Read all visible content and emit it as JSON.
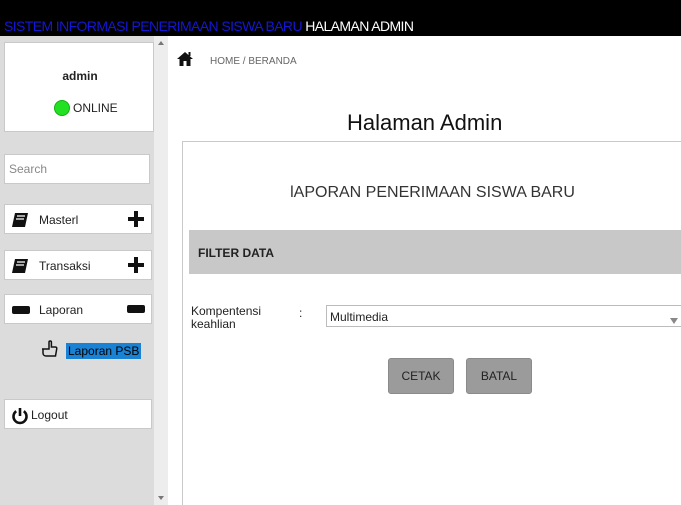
{
  "header": {
    "system_title": "SISTEM INFORMASI PENERIMAAN SISWA BARU",
    "admin_label": "HALAMAN ADMIN"
  },
  "sidebar": {
    "user": {
      "name": "admin",
      "status": "ONLINE",
      "status_color": "#22e022"
    },
    "search_placeholder": "Search",
    "menu": {
      "master": "Masterl",
      "transaksi": "Transaksi",
      "laporan": "Laporan",
      "laporan_sub": "Laporan PSB",
      "logout": "Logout"
    }
  },
  "main": {
    "breadcrumb": "HOME / BERANDA",
    "page_title": "Halaman Admin",
    "report_title": "lAPORAN PENERIMAAN SISWA BARU",
    "filter_title": "FILTER DATA",
    "form": {
      "field_label": "Kompentensi keahlian",
      "colon": ":",
      "selected_value": "Multimedia"
    },
    "buttons": {
      "print": "CETAK",
      "cancel": "BATAL"
    }
  },
  "colors": {
    "topbar": "#000000",
    "system_title": "#1616d6",
    "submenu_highlight": "#1a82d4",
    "button": "#9b9b9b",
    "filter_bar": "#c8c8c8",
    "sidebar": "#dcdcdc"
  },
  "icons": {
    "home": "home-icon",
    "book": "book-icon",
    "plus": "plus-icon",
    "minus": "minus-icon",
    "hand": "hand-pointer-icon",
    "power": "power-icon"
  }
}
